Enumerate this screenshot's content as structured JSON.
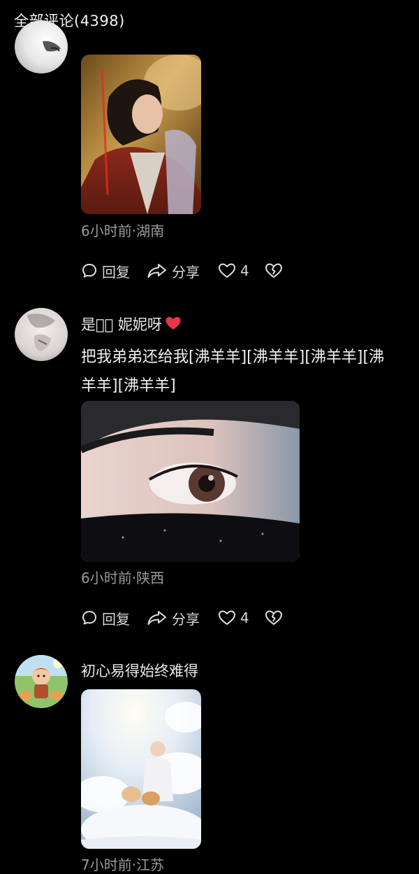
{
  "header": {
    "title": "全部评论(4398)"
  },
  "comments": [
    {
      "username": "",
      "text_lines": [],
      "meta": "6小时前·湖南",
      "reply_label": "回复",
      "share_label": "分享",
      "like_count": "4"
    },
    {
      "username": "是ෆ゚ 妮妮呀",
      "text_lines": [
        "把我弟弟还给我[沸羊羊][沸羊羊][沸羊羊][沸",
        "羊羊][沸羊羊]"
      ],
      "meta": "6小时前·陕西",
      "reply_label": "回复",
      "share_label": "分享",
      "like_count": "4"
    },
    {
      "username": "初心易得始终难得",
      "text_lines": [],
      "meta": "7小时前·江苏"
    }
  ],
  "icons": {
    "reply": "speech-bubble-icon",
    "share": "share-arrow-icon",
    "like": "heart-outline-icon",
    "dislike": "broken-heart-icon",
    "username_heart": "red-heart-icon"
  },
  "colors": {
    "background": "#000000",
    "text": "#f0f0f0",
    "meta": "#9a9a9a",
    "heart": "#e8334a"
  }
}
